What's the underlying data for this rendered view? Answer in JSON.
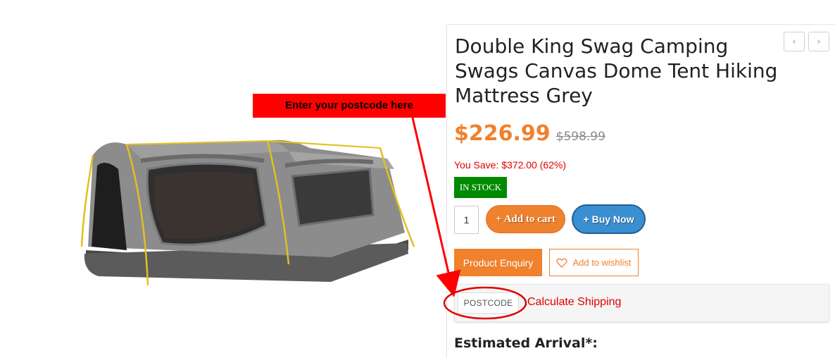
{
  "callout": {
    "text": "Enter your postcode here"
  },
  "product": {
    "title": "Double King Swag Camping Swags Canvas Dome Tent Hiking Mattress Grey",
    "price": "$226.99",
    "old_price": "$598.99",
    "you_save": "You Save: $372.00 (62%)",
    "stock_status": "IN STOCK",
    "quantity": "1"
  },
  "actions": {
    "add_to_cart": "+ Add to cart",
    "buy_now": "+ Buy Now",
    "product_enquiry": "Product Enquiry",
    "add_to_wishlist": "Add to wishlist"
  },
  "nav": {
    "prev_icon": "chevron-left-icon",
    "next_icon": "chevron-right-icon",
    "prev_glyph": "‹",
    "next_glyph": "›"
  },
  "shipping": {
    "postcode_label": "POSTCODE",
    "calculate_label": "Calculate Shipping",
    "estimated_arrival": "Estimated Arrival*:"
  },
  "colors": {
    "accent": "#f0812d",
    "stock": "#008a00",
    "alert": "#e00000",
    "buy": "#3a8fd1",
    "callout": "#ff0000"
  }
}
